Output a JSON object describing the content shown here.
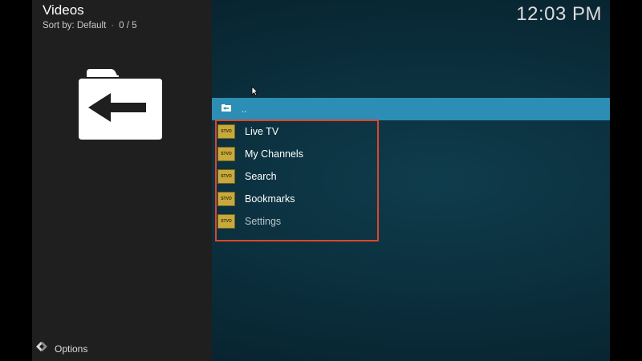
{
  "header": {
    "title": "Videos",
    "sort_label": "Sort by: Default",
    "count": "0 / 5",
    "clock": "12:03 PM"
  },
  "left_panel": {
    "icon": "folder-back-icon"
  },
  "list": {
    "parent_label": "..",
    "items": [
      {
        "label": "Live TV",
        "thumb": "STVO"
      },
      {
        "label": "My Channels",
        "thumb": "STVO"
      },
      {
        "label": "Search",
        "thumb": "STVO"
      },
      {
        "label": "Bookmarks",
        "thumb": "STVO"
      },
      {
        "label": "Settings",
        "thumb": "STVO"
      }
    ]
  },
  "footer": {
    "options_label": "Options"
  },
  "colors": {
    "accent": "#2c8db5",
    "highlight_box": "#e0452a",
    "thumb": "#c8aa3c"
  }
}
